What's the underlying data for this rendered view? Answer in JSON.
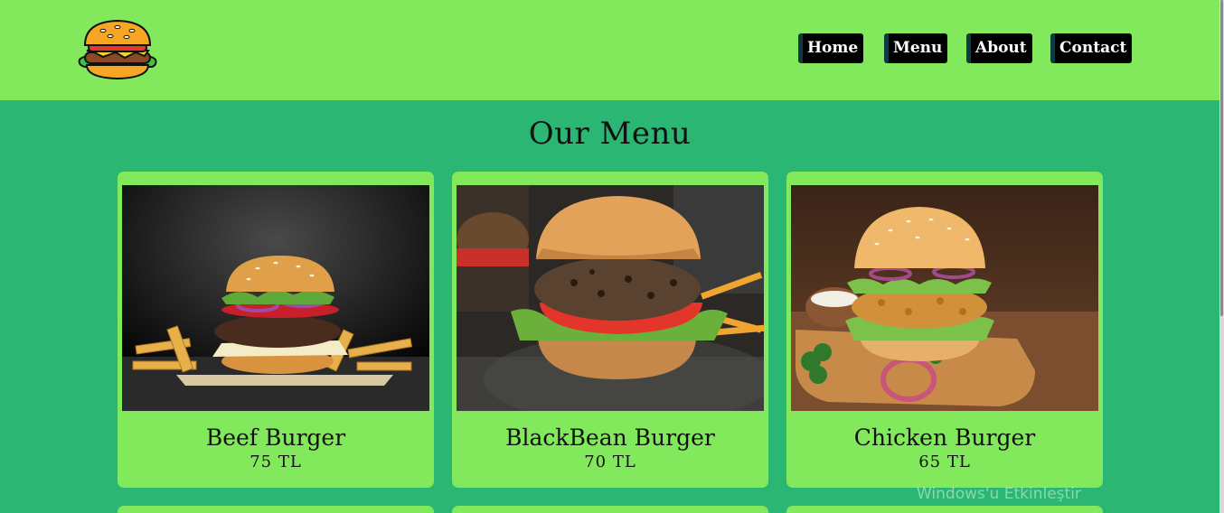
{
  "nav": {
    "items": [
      {
        "label": "Home"
      },
      {
        "label": "Menu"
      },
      {
        "label": "About"
      },
      {
        "label": "Contact"
      }
    ]
  },
  "main": {
    "title": "Our Menu",
    "cards": [
      {
        "name": "Beef Burger",
        "price": "75 TL",
        "image": "beef-burger-photo"
      },
      {
        "name": "BlackBean Burger",
        "price": "70 TL",
        "image": "blackbean-burger-photo"
      },
      {
        "name": "Chicken Burger",
        "price": "65 TL",
        "image": "chicken-burger-photo"
      }
    ]
  },
  "watermark": {
    "text": "Windows'u Etkinleştir"
  },
  "colors": {
    "header_bg": "#82e85c",
    "page_bg": "#2bb673",
    "card_bg": "#82e85c",
    "nav_button_bg": "#000000"
  }
}
